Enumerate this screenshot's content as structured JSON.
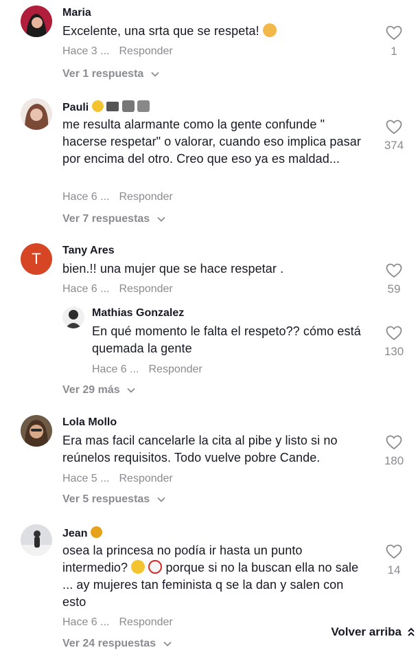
{
  "comments": [
    {
      "username": "Maria",
      "text": "Excelente, una srta que se respeta!",
      "time": "Hace 3 ...",
      "reply_label": "Responder",
      "likes": "1",
      "view_replies": "Ver 1 respuesta",
      "avatar_color": "#b01e3c"
    },
    {
      "username": "Pauli",
      "text": "me resulta alarmante como la gente confunde \" hacerse respetar\" o valorar, cuando eso implica pasar por encima del otro. Creo que eso ya es maldad...",
      "time": "Hace 6 ...",
      "reply_label": "Responder",
      "likes": "374",
      "view_replies": "Ver 7 respuestas",
      "avatar_color": "#c99a8a"
    },
    {
      "username": "Tany Ares",
      "avatar_letter": "T",
      "text": "bien.!! una mujer que se hace respetar .",
      "time": "Hace 6 ...",
      "reply_label": "Responder",
      "likes": "59",
      "avatar_color": "#d64624",
      "reply": {
        "username": "Mathias Gonzalez",
        "text": "En qué momento le falta el respeto?? cómo está quemada la gente",
        "time": "Hace 6 ...",
        "reply_label": "Responder",
        "likes": "130"
      },
      "view_replies": "Ver 29 más"
    },
    {
      "username": "Lola Mollo",
      "text": "Era mas facil cancelarle la cita al pibe y listo si no reúnelos requisitos. Todo vuelve pobre Cande.",
      "time": "Hace 5 ...",
      "reply_label": "Responder",
      "likes": "180",
      "view_replies": "Ver 5 respuestas",
      "avatar_color": "#8a6a50"
    },
    {
      "username": "Jean",
      "text": "osea la princesa no podía ir hasta un punto intermedio?",
      "text2": "porque si no la buscan ella no sale ... ay mujeres tan feminista q se la dan y salen con esto",
      "time": "Hace 6 ...",
      "reply_label": "Responder",
      "likes": "14",
      "view_replies": "Ver 24 respuestas",
      "avatar_color": "#d8dadd"
    }
  ],
  "back_to_top": "Volver arriba",
  "colors": {
    "text": "#161823",
    "muted": "#8a8b91",
    "background": "#ffffff"
  }
}
